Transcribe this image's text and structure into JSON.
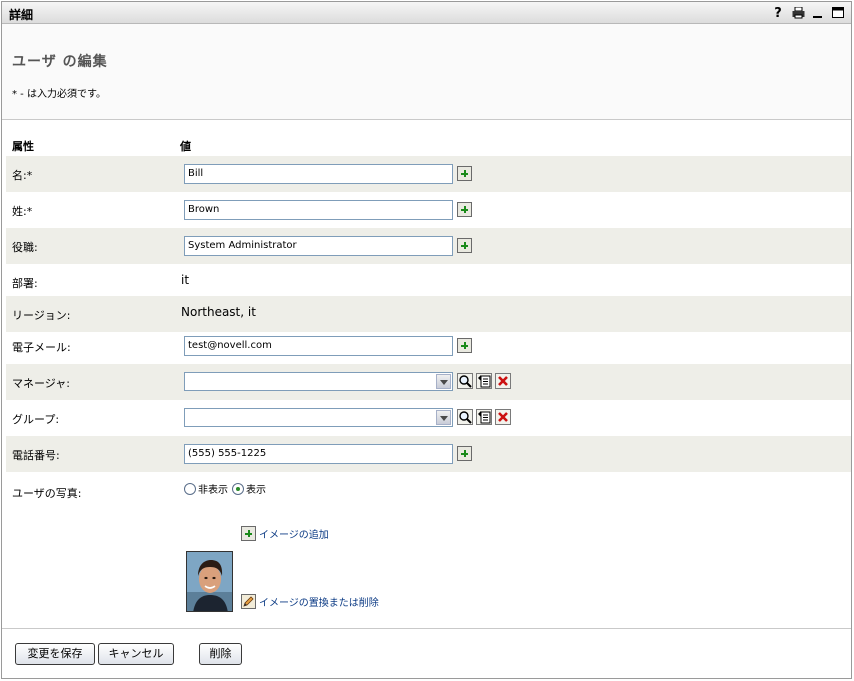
{
  "window": {
    "title": "詳細",
    "tools": [
      "help-icon",
      "print-icon",
      "minimize-icon",
      "maximize-icon"
    ],
    "help_glyph": "?"
  },
  "page": {
    "title": "ユーザ の編集",
    "required_note": "* - は入力必須です。"
  },
  "table": {
    "header_attribute": "属性",
    "header_value": "値"
  },
  "fields": {
    "first_name": {
      "label": "名:*",
      "value": "Bill"
    },
    "last_name": {
      "label": "姓:*",
      "value": "Brown"
    },
    "title": {
      "label": "役職:",
      "value": "System Administrator"
    },
    "department": {
      "label": "部署:",
      "value": "it"
    },
    "region": {
      "label": "リージョン:",
      "value": "Northeast, it"
    },
    "email": {
      "label": "電子メール:",
      "value": "test@novell.com"
    },
    "manager": {
      "label": "マネージャ:",
      "value": ""
    },
    "group": {
      "label": "グループ:",
      "value": ""
    },
    "phone": {
      "label": "電話番号:",
      "value": "(555) 555-1225"
    },
    "photo": {
      "label": "ユーザの写真:",
      "option_hide": "非表示",
      "option_show": "表示",
      "selected": "表示",
      "add_image": "イメージの追加",
      "replace_image": "イメージの置換または削除"
    }
  },
  "buttons": {
    "save": "変更を保存",
    "cancel": "キャンセル",
    "delete": "削除"
  },
  "colors": {
    "row_shade": "#eeeee8",
    "link": "#0b3a84",
    "add_green": "#1a8a1a",
    "delete_red": "#cc1111"
  }
}
